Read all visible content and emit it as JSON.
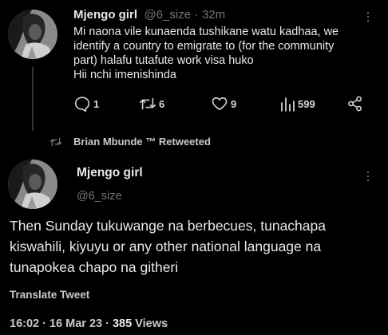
{
  "tweet1": {
    "name": "Mjengo girl",
    "handle": "@6_size",
    "separator": "·",
    "time": "32m",
    "lines": [
      "Mi naona vile kunaenda tushikane watu kadhaa, we",
      "identify a country to emigrate to (for the community",
      "part) halafu tutafute work visa huko",
      "Hii nchi imenishinda"
    ],
    "actions": {
      "replies": "1",
      "retweets": "6",
      "likes": "9",
      "views": "599"
    }
  },
  "retweet_banner": {
    "label": "Brian Mbunde ™ Retweeted"
  },
  "tweet2": {
    "name": "Mjengo girl",
    "handle": "@6_size",
    "lines": [
      "Then Sunday tukuwange na berbecues, tunachapa",
      "kiswahili, kiyuyu or any other national language na",
      "tunapokea chapo na githeri"
    ],
    "translate_label": "Translate Tweet",
    "timestamp": "16:02 · 16 Mar 23 ·",
    "views_count": "385",
    "views_label": "Views"
  },
  "icons": {
    "reply": "reply-icon",
    "retweet": "retweet-icon",
    "like": "heart-icon",
    "views": "analytics-icon",
    "share": "share-icon",
    "more": "more-dots-icon"
  }
}
